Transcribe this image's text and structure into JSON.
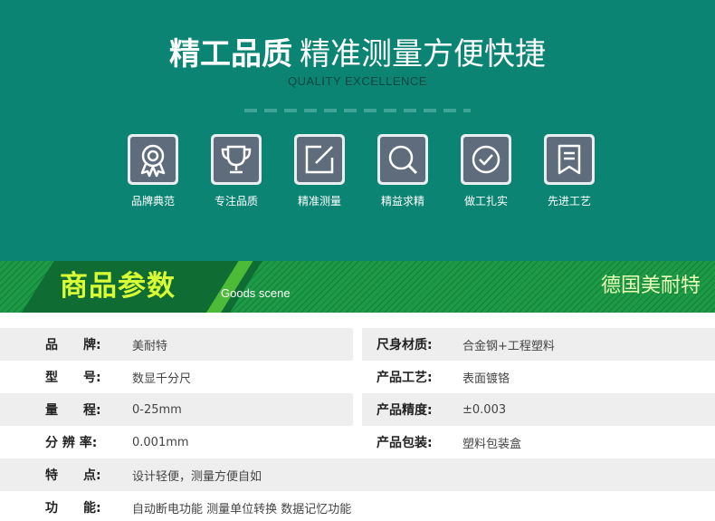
{
  "hero": {
    "title_strong": "精工品质",
    "title_light": "精准测量方便快捷",
    "subtitle": "QUALITY EXCELLENCE",
    "features": [
      {
        "icon": "award-ribbon-icon",
        "label": "品牌典范"
      },
      {
        "icon": "trophy-icon",
        "label": "专注品质"
      },
      {
        "icon": "edit-square-icon",
        "label": "精准测量"
      },
      {
        "icon": "magnifier-icon",
        "label": "精益求精"
      },
      {
        "icon": "check-circle-icon",
        "label": "做工扎实"
      },
      {
        "icon": "bookmark-document-icon",
        "label": "先进工艺"
      }
    ]
  },
  "banner": {
    "title": "商品参数",
    "subtitle": "Goods scene",
    "brand": "德国美耐特"
  },
  "specs": {
    "brand": {
      "key": "品　　牌:",
      "value": "美耐特"
    },
    "model": {
      "key": "型　　号:",
      "value": "数显千分尺"
    },
    "range": {
      "key": "量　　程:",
      "value": "0-25mm"
    },
    "resolution": {
      "key": "分 辨 率:",
      "value": "0.001mm"
    },
    "material": {
      "key": "尺身材质:",
      "value": "合金钢+工程塑料"
    },
    "process": {
      "key": "产品工艺:",
      "value": "表面镀铬"
    },
    "accuracy": {
      "key": "产品精度:",
      "value": "±0.003"
    },
    "package": {
      "key": "产品包装:",
      "value": "塑料包装盒"
    },
    "features": {
      "key": "特　　点:",
      "value": "设计轻便，测量方便自如"
    },
    "functions": {
      "key": "功　　能:",
      "value": "自动断电功能  测量单位转换  数据记忆功能"
    }
  },
  "colors": {
    "hero_bg": "#0c8473",
    "banner_bg": "#1c9a46",
    "banner_title": "#d8ff35",
    "icon_tile": "#5f6c7b",
    "row_gray": "#eeeeee"
  }
}
